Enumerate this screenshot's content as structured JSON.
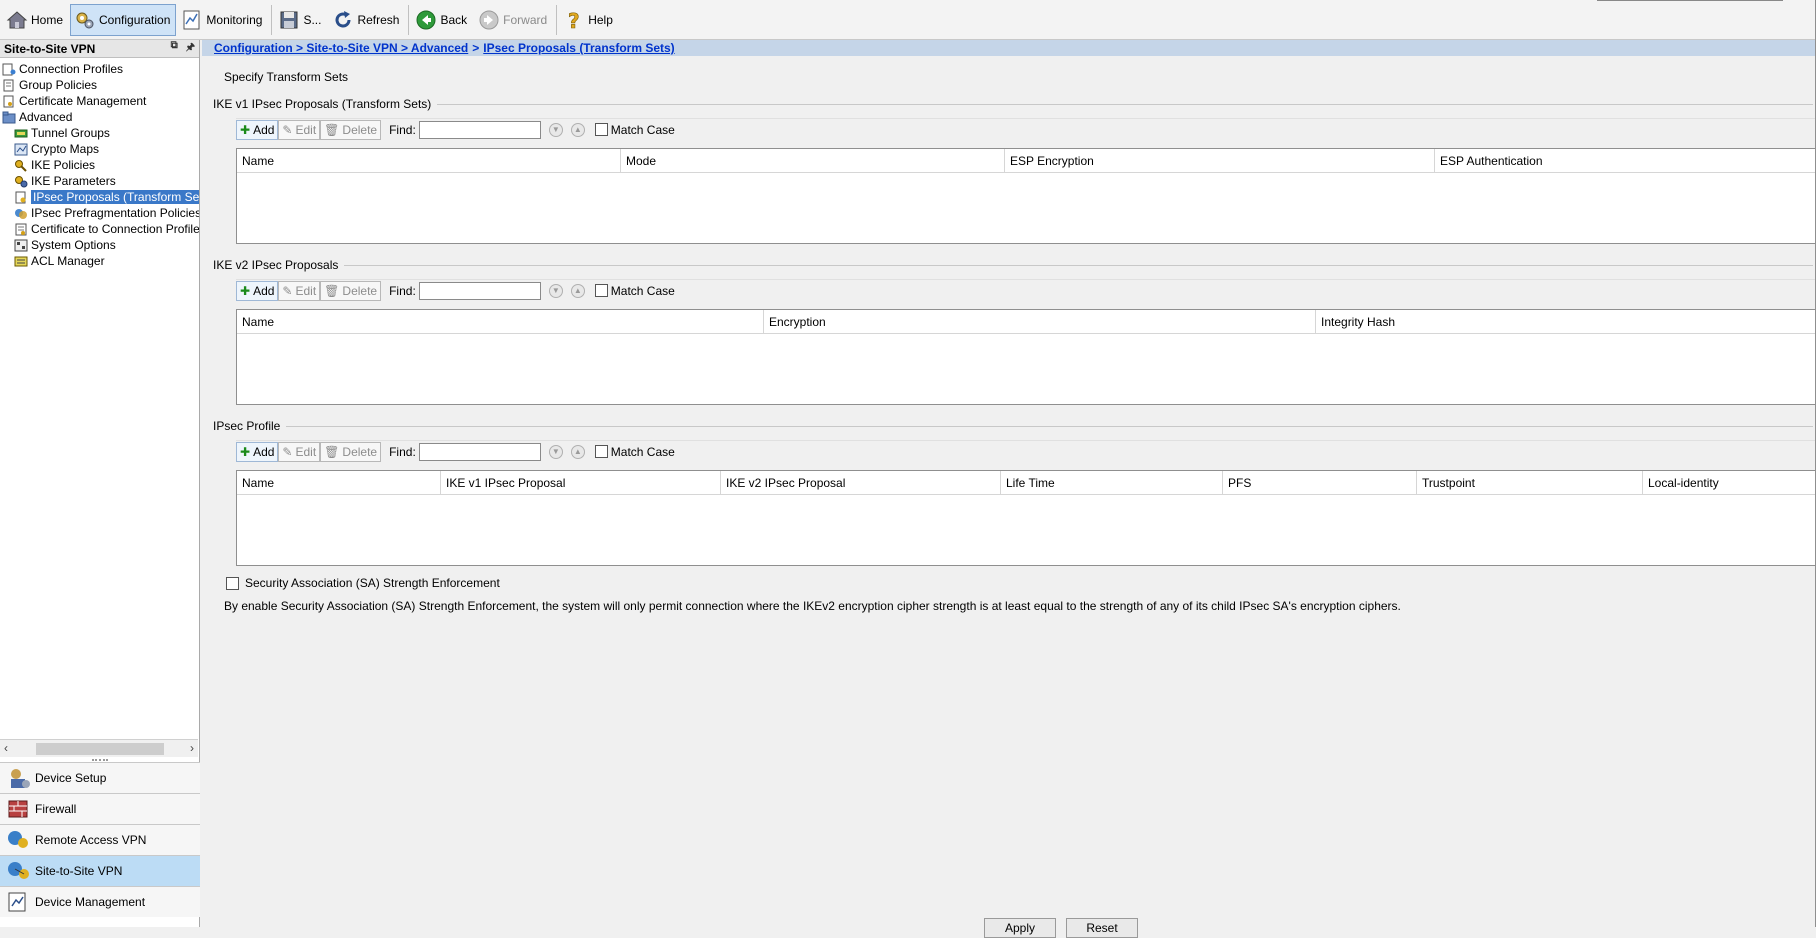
{
  "toolbar": {
    "home": "Home",
    "configuration": "Configuration",
    "monitoring": "Monitoring",
    "save": "S...",
    "refresh": "Refresh",
    "back": "Back",
    "forward": "Forward",
    "help": "Help"
  },
  "nav": {
    "title": "Site-to-Site VPN",
    "tree": [
      {
        "label": "Connection Profiles",
        "icon": "connection-profiles-icon"
      },
      {
        "label": "Group Policies",
        "icon": "group-policies-icon"
      },
      {
        "label": "Certificate Management",
        "icon": "certificate-icon"
      },
      {
        "label": "Advanced",
        "icon": "folder-icon"
      },
      {
        "label": "Tunnel Groups",
        "icon": "tunnel-groups-icon"
      },
      {
        "label": "Crypto Maps",
        "icon": "crypto-maps-icon"
      },
      {
        "label": "IKE Policies",
        "icon": "ike-policies-icon"
      },
      {
        "label": "IKE Parameters",
        "icon": "ike-parameters-icon"
      },
      {
        "label": "IPsec Proposals (Transform Sets)",
        "icon": "ipsec-proposals-icon"
      },
      {
        "label": "IPsec Prefragmentation Policies",
        "icon": "prefragmentation-icon"
      },
      {
        "label": "Certificate to Connection Profile M",
        "icon": "certificate-map-icon"
      },
      {
        "label": "System Options",
        "icon": "system-options-icon"
      },
      {
        "label": "ACL Manager",
        "icon": "acl-manager-icon"
      }
    ],
    "sections": [
      {
        "label": "Device Setup"
      },
      {
        "label": "Firewall"
      },
      {
        "label": "Remote Access VPN"
      },
      {
        "label": "Site-to-Site VPN"
      },
      {
        "label": "Device Management"
      }
    ]
  },
  "breadcrumb": {
    "path": "Configuration > Site-to-Site VPN > Advanced",
    "separator": ">",
    "current": "IPsec Proposals (Transform Sets)"
  },
  "page_title": "Specify Transform Sets",
  "common": {
    "add": "Add",
    "edit": "Edit",
    "delete": "Delete",
    "find": "Find:",
    "match_case": "Match Case"
  },
  "ikev1": {
    "label": "IKE v1 IPsec Proposals (Transform Sets)",
    "columns": [
      "Name",
      "Mode",
      "ESP Encryption",
      "ESP Authentication"
    ]
  },
  "ikev2": {
    "label": "IKE v2 IPsec Proposals",
    "columns": [
      "Name",
      "Encryption",
      "Integrity Hash"
    ]
  },
  "profile": {
    "label": "IPsec Profile",
    "columns": [
      "Name",
      "IKE v1 IPsec Proposal",
      "IKE v2 IPsec Proposal",
      "Life Time",
      "PFS",
      "Trustpoint",
      "Local-identity"
    ]
  },
  "sa": {
    "checkbox_label": "Security Association (SA) Strength Enforcement",
    "note": "By enable Security Association (SA) Strength Enforcement, the system will only permit connection where the IKEv2 encryption cipher strength is at least equal to the strength of any of its child IPsec SA's encryption ciphers."
  },
  "bottom": {
    "apply": "Apply",
    "reset": "Reset"
  }
}
